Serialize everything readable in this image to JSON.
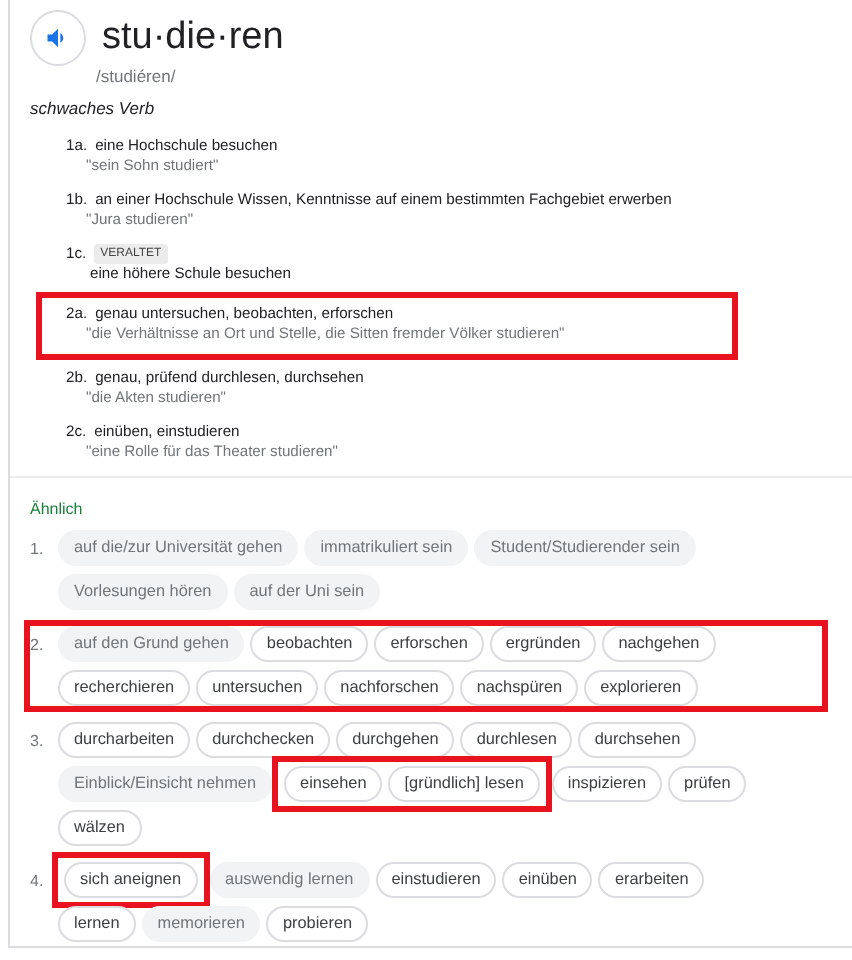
{
  "headword": {
    "word": "stu·die·ren",
    "pronunciation": "/studiéren/"
  },
  "part_of_speech": "schwaches Verb",
  "senses": [
    {
      "number": "1a.",
      "definition": "eine Hochschule besuchen",
      "example": "\"sein Sohn studiert\"",
      "highlighted": false
    },
    {
      "number": "1b.",
      "definition": "an einer Hochschule Wissen, Kenntnisse auf einem bestimmten Fachgebiet erwerben",
      "example": "\"Jura studieren\"",
      "highlighted": false
    },
    {
      "number": "1c.",
      "label": "VERALTET",
      "definition": "eine höhere Schule besuchen",
      "highlighted": false
    },
    {
      "number": "2a.",
      "definition": "genau untersuchen, beobachten, erforschen",
      "example": "\"die Verhältnisse an Ort und Stelle, die Sitten fremder Völker studieren\"",
      "highlighted": true
    },
    {
      "number": "2b.",
      "definition": "genau, prüfend durchlesen, durchsehen",
      "example": "\"die Akten studieren\"",
      "highlighted": false
    },
    {
      "number": "2c.",
      "definition": "einüben, einstudieren",
      "example": "\"eine Rolle für das Theater studieren\"",
      "highlighted": false
    }
  ],
  "similar": {
    "heading": "Ähnlich",
    "groups": [
      {
        "number": "1.",
        "highlighted": false,
        "chips": [
          {
            "text": "auf die/zur Universität gehen",
            "kind": "filled",
            "highlighted": false
          },
          {
            "text": "immatrikuliert sein",
            "kind": "filled",
            "highlighted": false
          },
          {
            "text": "Student/Studierender sein",
            "kind": "filled",
            "highlighted": false
          },
          {
            "text": "Vorlesungen hören",
            "kind": "filled",
            "highlighted": false
          },
          {
            "text": "auf der Uni sein",
            "kind": "filled",
            "highlighted": false
          }
        ]
      },
      {
        "number": "2.",
        "highlighted": true,
        "chips": [
          {
            "text": "auf den Grund gehen",
            "kind": "filled",
            "highlighted": false
          },
          {
            "text": "beobachten",
            "kind": "outlined",
            "highlighted": false
          },
          {
            "text": "erforschen",
            "kind": "outlined",
            "highlighted": false
          },
          {
            "text": "ergründen",
            "kind": "outlined",
            "highlighted": false
          },
          {
            "text": "nachgehen",
            "kind": "outlined",
            "highlighted": false
          },
          {
            "text": "recherchieren",
            "kind": "outlined",
            "highlighted": false
          },
          {
            "text": "untersuchen",
            "kind": "outlined",
            "highlighted": false
          },
          {
            "text": "nachforschen",
            "kind": "outlined",
            "highlighted": false
          },
          {
            "text": "nachspüren",
            "kind": "outlined",
            "highlighted": false
          },
          {
            "text": "explorieren",
            "kind": "outlined",
            "highlighted": false
          }
        ]
      },
      {
        "number": "3.",
        "highlighted": false,
        "chips": [
          {
            "text": "durcharbeiten",
            "kind": "outlined",
            "highlighted": false
          },
          {
            "text": "durchchecken",
            "kind": "outlined",
            "highlighted": false
          },
          {
            "text": "durchgehen",
            "kind": "outlined",
            "highlighted": false
          },
          {
            "text": "durchlesen",
            "kind": "outlined",
            "highlighted": false
          },
          {
            "text": "durchsehen",
            "kind": "outlined",
            "highlighted": false
          },
          {
            "text": "Einblick/Einsicht nehmen",
            "kind": "filled",
            "highlighted": false
          },
          {
            "text": "einsehen",
            "kind": "outlined",
            "highlighted": true
          },
          {
            "text": "[gründlich] lesen",
            "kind": "outlined",
            "highlighted": true
          },
          {
            "text": "inspizieren",
            "kind": "outlined",
            "highlighted": false
          },
          {
            "text": "prüfen",
            "kind": "outlined",
            "highlighted": false
          },
          {
            "text": "wälzen",
            "kind": "outlined",
            "highlighted": false
          }
        ]
      },
      {
        "number": "4.",
        "highlighted": false,
        "chips": [
          {
            "text": "sich aneignen",
            "kind": "outlined",
            "highlighted": true
          },
          {
            "text": "auswendig lernen",
            "kind": "filled",
            "highlighted": false
          },
          {
            "text": "einstudieren",
            "kind": "outlined",
            "highlighted": false
          },
          {
            "text": "einüben",
            "kind": "outlined",
            "highlighted": false
          },
          {
            "text": "erarbeiten",
            "kind": "outlined",
            "highlighted": false
          },
          {
            "text": "lernen",
            "kind": "outlined",
            "highlighted": false
          },
          {
            "text": "memorieren",
            "kind": "filled",
            "highlighted": false
          },
          {
            "text": "probieren",
            "kind": "outlined",
            "highlighted": false
          }
        ]
      }
    ]
  }
}
